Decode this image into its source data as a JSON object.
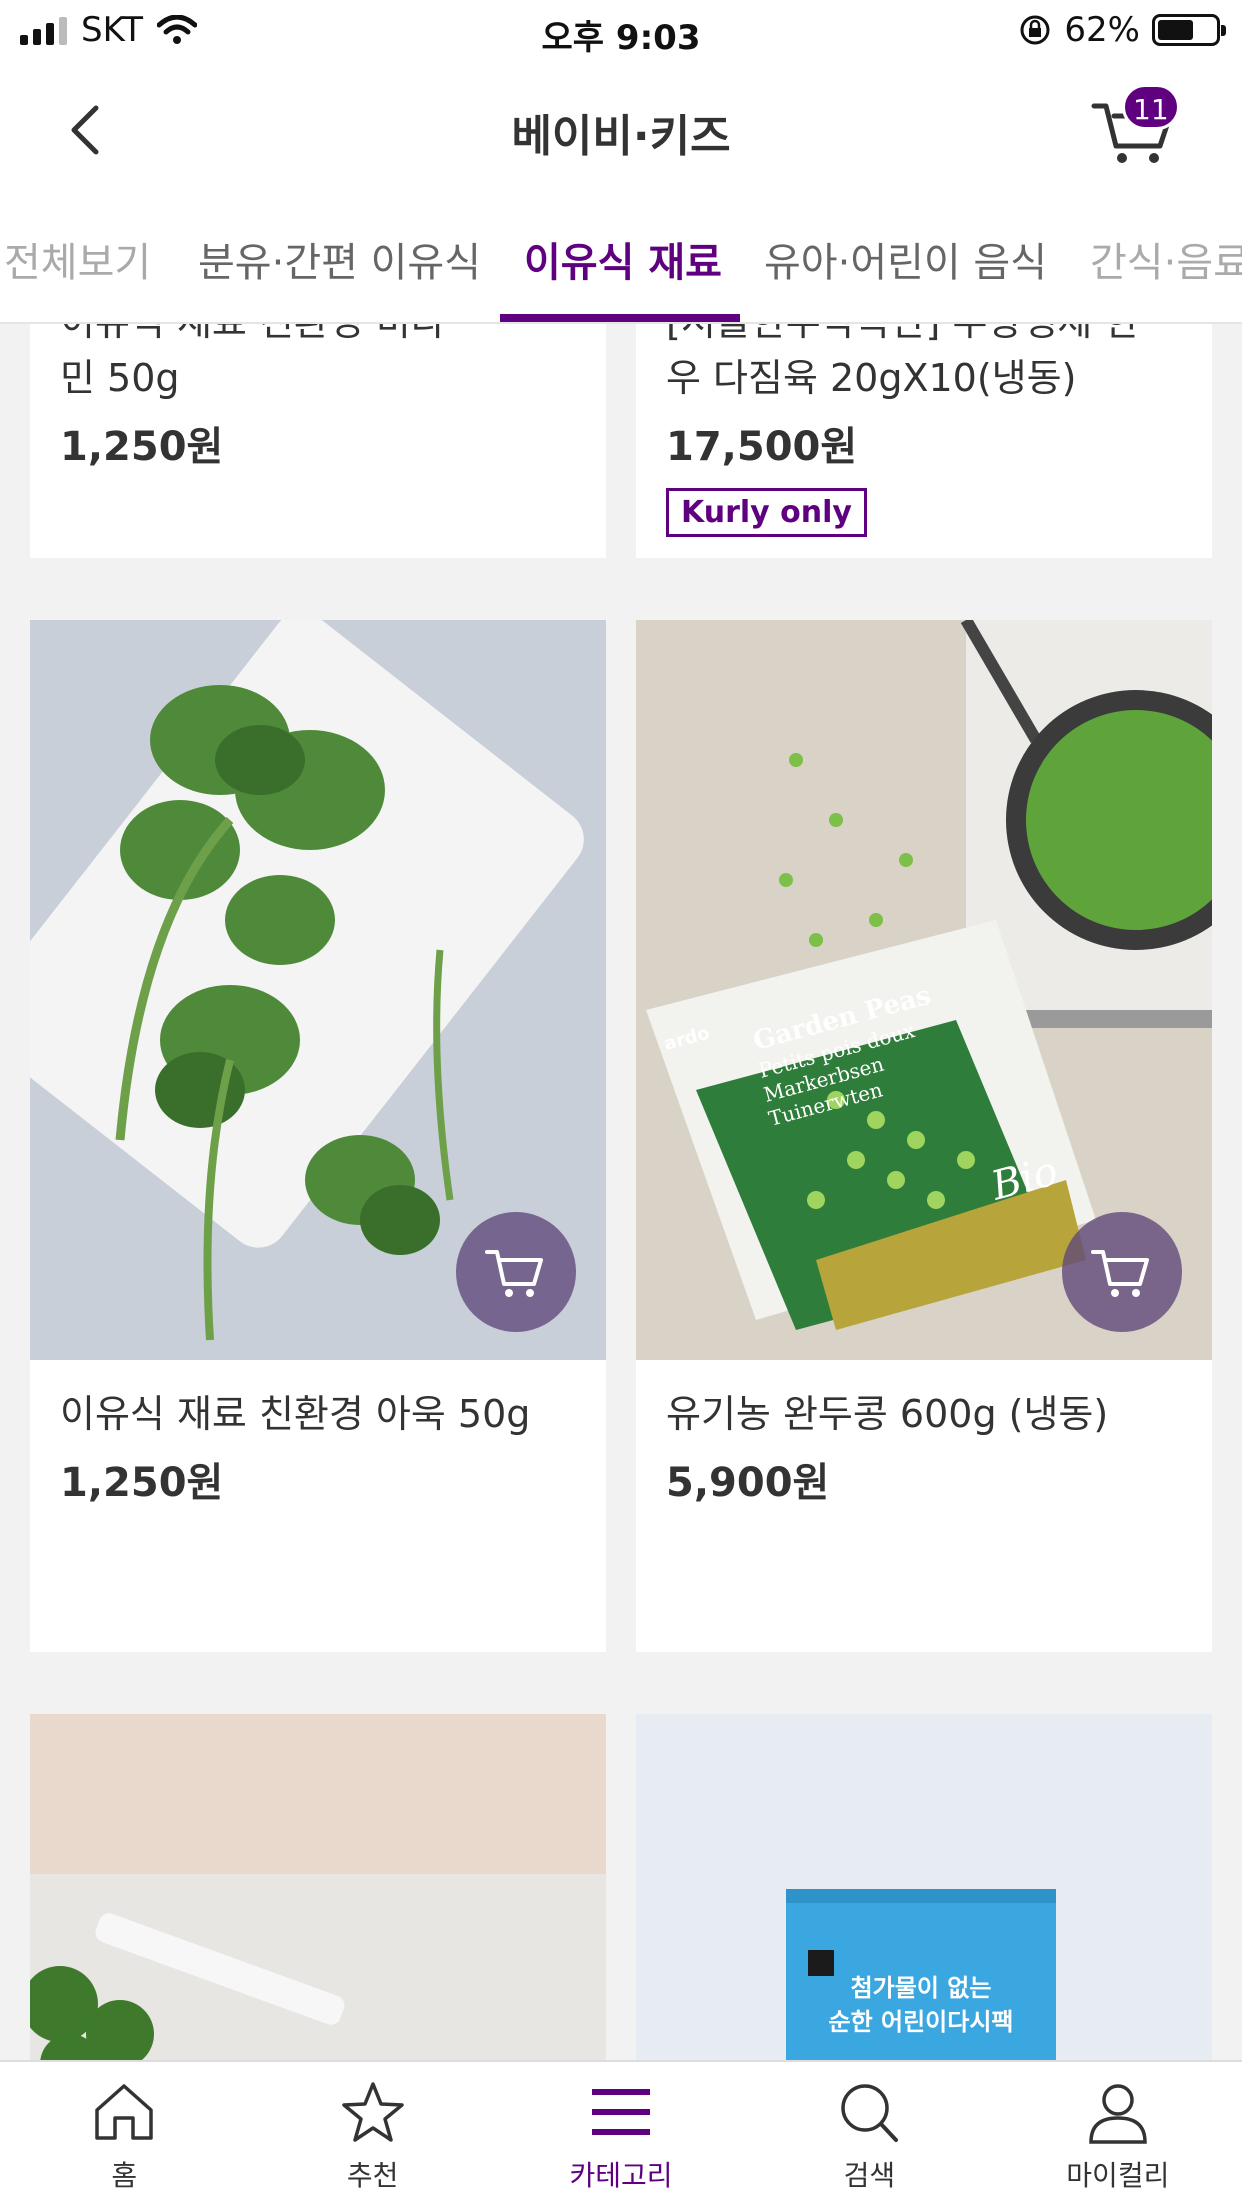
{
  "status_bar": {
    "carrier": "SKT",
    "time": "오후 9:03",
    "battery": "62%",
    "battery_level": 0.62
  },
  "header": {
    "title": "베이비·키즈",
    "cart_count": "11"
  },
  "tabs": [
    {
      "label": "전체보기"
    },
    {
      "label": "분유·간편 이유식"
    },
    {
      "label": "이유식 재료"
    },
    {
      "label": "유아·어린이 음식"
    },
    {
      "label": "간식·음료"
    }
  ],
  "products_top": [
    {
      "name_line1": "이유식 재료 친환경 비타",
      "name_line2": "민 50g",
      "price": "1,250원"
    },
    {
      "name_line1": "[서울한우작목반] 무항생제 한",
      "name_line2": "우 다짐육 20gX10(냉동)",
      "price": "17,500원",
      "badge": "Kurly only"
    }
  ],
  "products_mid": [
    {
      "name": "이유식 재료 친환경 아욱 50g",
      "price": "1,250원"
    },
    {
      "name": "유기농 완두콩 600g (냉동)",
      "price": "5,900원"
    }
  ],
  "package_texts": {
    "peas_line1": "Garden Peas",
    "peas_line2": "Petits pois doux",
    "peas_line3": "Markerbsen",
    "peas_line4": "Tuinerwten",
    "peas_brand": "ardo",
    "peas_bio": "Bio",
    "dashi_line1": "첨가물이 없는",
    "dashi_line2": "순한 어린이다시팩"
  },
  "bottom_nav": [
    {
      "label": "홈",
      "icon": "home-icon"
    },
    {
      "label": "추천",
      "icon": "star-icon"
    },
    {
      "label": "카테고리",
      "icon": "menu-icon"
    },
    {
      "label": "검색",
      "icon": "search-icon"
    },
    {
      "label": "마이컬리",
      "icon": "user-icon"
    }
  ],
  "colors": {
    "accent": "#5f0080",
    "background": "#f2f2f2"
  }
}
